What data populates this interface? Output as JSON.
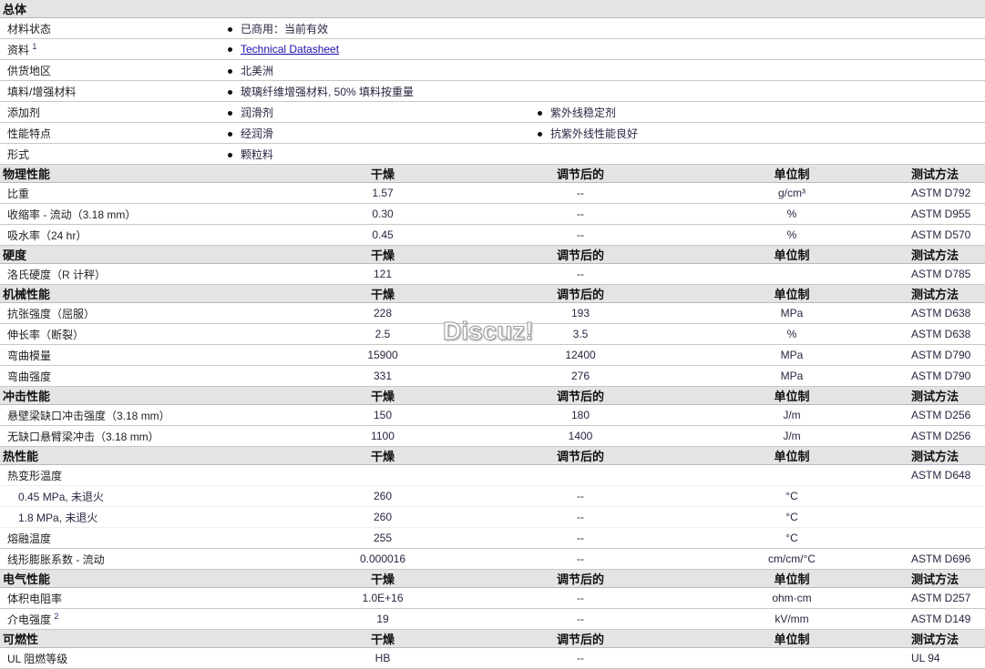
{
  "general": {
    "title": "总体",
    "rows": [
      {
        "label": "材料状态",
        "values": [
          "已商用：当前有效"
        ]
      },
      {
        "label": "资料",
        "sup": "1",
        "values": [
          "Technical Datasheet"
        ],
        "link": true
      },
      {
        "label": "供货地区",
        "values": [
          "北美洲"
        ]
      },
      {
        "label": "填料/增强材料",
        "values": [
          "玻璃纤维增强材料, 50% 填料按重量"
        ]
      },
      {
        "label": "添加剂",
        "values": [
          "润滑剂",
          "紫外线稳定剂"
        ]
      },
      {
        "label": "性能特点",
        "values": [
          "经润滑",
          "抗紫外线性能良好"
        ]
      },
      {
        "label": "形式",
        "values": [
          "颗粒料"
        ]
      }
    ]
  },
  "columns": {
    "dry": "干燥",
    "conditioned": "调节后的",
    "unit": "单位制",
    "method": "测试方法"
  },
  "sections": [
    {
      "title": "物理性能",
      "rows": [
        {
          "label": "比重",
          "dry": "1.57",
          "cond": "--",
          "unit": "g/cm³",
          "method": "ASTM D792"
        },
        {
          "label": "收缩率 - 流动（3.18 mm）",
          "dry": "0.30",
          "cond": "--",
          "unit": "%",
          "method": "ASTM D955"
        },
        {
          "label": "吸水率（24 hr）",
          "dry": "0.45",
          "cond": "--",
          "unit": "%",
          "method": "ASTM D570"
        }
      ]
    },
    {
      "title": "硬度",
      "rows": [
        {
          "label": "洛氏硬度（R 计秤）",
          "dry": "121",
          "cond": "--",
          "unit": "",
          "method": "ASTM D785"
        }
      ]
    },
    {
      "title": "机械性能",
      "rows": [
        {
          "label": "抗张强度（屈服）",
          "dry": "228",
          "cond": "193",
          "unit": "MPa",
          "method": "ASTM D638"
        },
        {
          "label": "伸长率（断裂）",
          "dry": "2.5",
          "cond": "3.5",
          "unit": "%",
          "method": "ASTM D638"
        },
        {
          "label": "弯曲模量",
          "dry": "15900",
          "cond": "12400",
          "unit": "MPa",
          "method": "ASTM D790"
        },
        {
          "label": "弯曲强度",
          "dry": "331",
          "cond": "276",
          "unit": "MPa",
          "method": "ASTM D790"
        }
      ]
    },
    {
      "title": "冲击性能",
      "rows": [
        {
          "label": "悬壁梁缺口冲击强度（3.18 mm）",
          "dry": "150",
          "cond": "180",
          "unit": "J/m",
          "method": "ASTM D256"
        },
        {
          "label": "无缺口悬臂梁冲击（3.18 mm）",
          "dry": "1100",
          "cond": "1400",
          "unit": "J/m",
          "method": "ASTM D256"
        }
      ]
    },
    {
      "title": "热性能",
      "rows": [
        {
          "label": "热变形温度",
          "dry": "",
          "cond": "",
          "unit": "",
          "method": "ASTM D648",
          "group": true
        },
        {
          "label": "0.45 MPa, 未退火",
          "dry": "260",
          "cond": "--",
          "unit": "°C",
          "method": "",
          "sub": true
        },
        {
          "label": "1.8 MPa, 未退火",
          "dry": "260",
          "cond": "--",
          "unit": "°C",
          "method": "",
          "sub": true
        },
        {
          "label": "熔融温度",
          "dry": "255",
          "cond": "--",
          "unit": "°C",
          "method": ""
        },
        {
          "label": "线形膨胀系数 - 流动",
          "dry": "0.000016",
          "cond": "--",
          "unit": "cm/cm/°C",
          "method": "ASTM D696"
        }
      ]
    },
    {
      "title": "电气性能",
      "rows": [
        {
          "label": "体积电阻率",
          "dry": "1.0E+16",
          "cond": "--",
          "unit": "ohm·cm",
          "method": "ASTM D257"
        },
        {
          "label": "介电强度",
          "sup": "2",
          "dry": "19",
          "cond": "--",
          "unit": "kV/mm",
          "method": "ASTM D149"
        }
      ]
    },
    {
      "title": "可燃性",
      "rows": [
        {
          "label": "UL 阻燃等级",
          "dry": "HB",
          "cond": "--",
          "unit": "",
          "method": "UL 94"
        }
      ]
    }
  ],
  "watermark": "Discuz!"
}
